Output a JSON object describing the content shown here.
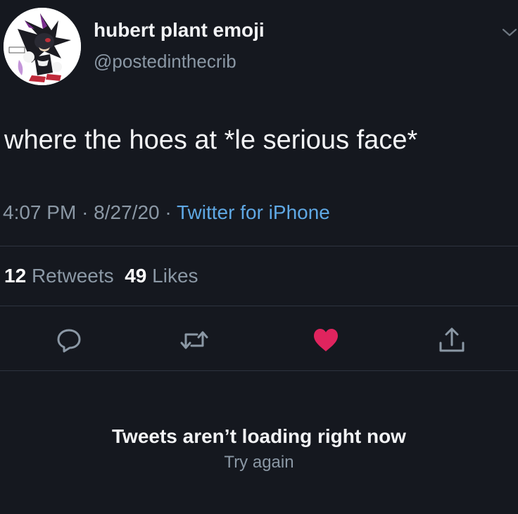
{
  "tweet": {
    "author": {
      "display_name": "hubert plant emoji",
      "handle": "@postedinthecrib",
      "avatar_icon": "hedgehog-character-avatar"
    },
    "text": "where the hoes at *le serious face*",
    "time": "4:07 PM",
    "date": "8/27/20",
    "separator": "·",
    "source": "Twitter for iPhone"
  },
  "stats": {
    "retweets_count": "12",
    "retweets_label": "Retweets",
    "likes_count": "49",
    "likes_label": "Likes"
  },
  "actions": [
    {
      "name": "reply",
      "icon": "reply-icon"
    },
    {
      "name": "retweet",
      "icon": "retweet-icon"
    },
    {
      "name": "like",
      "icon": "heart-icon",
      "active": true
    },
    {
      "name": "share",
      "icon": "share-icon"
    }
  ],
  "colors": {
    "background": "#15181f",
    "like_active": "#e0245e",
    "link": "#5fa8e4",
    "muted": "#8b98a5"
  },
  "error": {
    "title": "Tweets aren’t loading right now",
    "retry_label": "Try again"
  }
}
